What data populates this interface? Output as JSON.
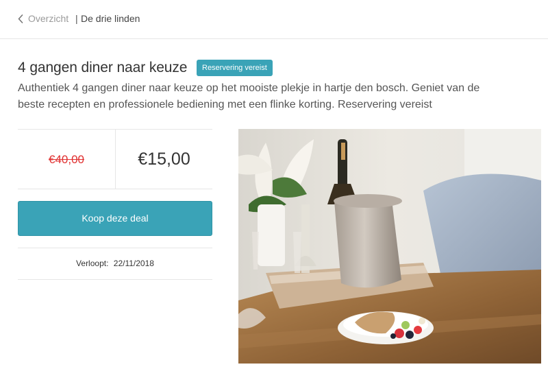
{
  "nav": {
    "back_label": "Overzicht",
    "separator": "|",
    "current": "De drie linden"
  },
  "deal": {
    "title": "4 gangen diner naar keuze",
    "badge": "Reservering vereist",
    "description": "Authentiek 4 gangen diner naar keuze op het mooiste plekje in hartje den bosch. Geniet van de beste recepten en professionele bediening met een flinke korting. Reservering vereist",
    "old_price": "€40,00",
    "new_price": "€15,00",
    "buy_label": "Koop deze deal",
    "expiry_label": "Verloopt:",
    "expiry_date": "22/11/2018"
  },
  "colors": {
    "accent": "#3aa3b7",
    "old_price": "#e03030"
  },
  "icons": {
    "back": "chevron-left-icon"
  }
}
